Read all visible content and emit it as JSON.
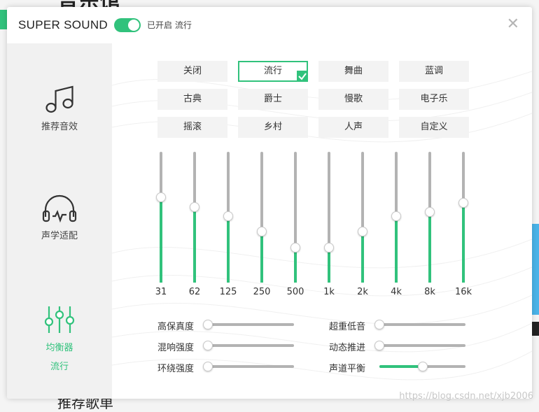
{
  "background": {
    "title": "音乐馆",
    "bottom_text": "推荐歌单",
    "watermark": "https://blog.csdn.net/xjb2006"
  },
  "header": {
    "app_title": "SUPER SOUND",
    "toggle_on": true,
    "status": "已开启 流行",
    "close_icon": "close-icon"
  },
  "sidebar": {
    "items": [
      {
        "label": "推荐音效",
        "icon": "music-note-icon",
        "active": false
      },
      {
        "label": "声学适配",
        "icon": "headphones-icon",
        "active": false
      },
      {
        "label": "均衡器",
        "sub": "流行",
        "icon": "equalizer-icon",
        "active": true
      }
    ]
  },
  "presets": {
    "items": [
      "关闭",
      "流行",
      "舞曲",
      "蓝调",
      "古典",
      "爵士",
      "慢歌",
      "电子乐",
      "摇滚",
      "乡村",
      "人声",
      "自定义"
    ],
    "selected": "流行"
  },
  "equalizer": {
    "bands": [
      "31",
      "62",
      "125",
      "250",
      "500",
      "1k",
      "2k",
      "4k",
      "8k",
      "16k"
    ],
    "levels": [
      0.65,
      0.58,
      0.51,
      0.39,
      0.27,
      0.27,
      0.39,
      0.51,
      0.54,
      0.61
    ]
  },
  "effects": {
    "left": [
      {
        "label": "高保真度",
        "value": 0
      },
      {
        "label": "混响强度",
        "value": 0
      },
      {
        "label": "环绕强度",
        "value": 0
      }
    ],
    "right": [
      {
        "label": "超重低音",
        "value": 0
      },
      {
        "label": "动态推进",
        "value": 0
      },
      {
        "label": "声道平衡",
        "value": 0.5
      }
    ]
  },
  "colors": {
    "accent": "#31c27c",
    "track": "#b3b3b3"
  }
}
